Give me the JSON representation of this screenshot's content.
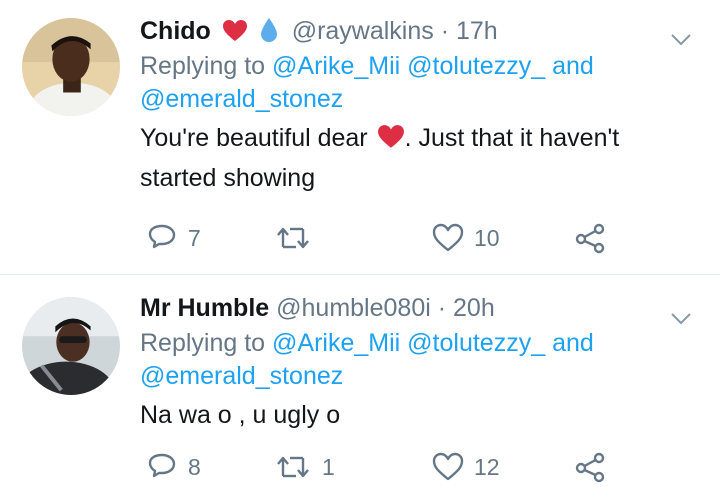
{
  "tweets": [
    {
      "name": "Chido",
      "name_emoji": [
        "red-heart",
        "water-droplet"
      ],
      "handle": "@raywalkins",
      "separator": "·",
      "time": "17h",
      "replying_prefix": "Replying to",
      "replying_users": [
        "@Arike_Mii",
        "@tolutezzy_"
      ],
      "replying_conjunction": "and",
      "replying_last": "@emerald_stonez",
      "text_before_emoji": "You're beautiful dear",
      "text_emoji": "red-heart",
      "text_after_emoji": ". Just that it haven't started showing",
      "reply_count": "7",
      "retweet_count": "",
      "like_count": "10"
    },
    {
      "name": "Mr Humble",
      "handle": "@humble080i",
      "separator": "·",
      "time": "20h",
      "replying_prefix": "Replying to",
      "replying_users": [
        "@Arike_Mii",
        "@tolutezzy_"
      ],
      "replying_conjunction": "and",
      "replying_last": "@emerald_stonez",
      "text": "Na wa o , u ugly o",
      "reply_count": "8",
      "retweet_count": "1",
      "like_count": "12"
    }
  ],
  "colors": {
    "text": "#14171a",
    "muted": "#657786",
    "link": "#1da1f2",
    "divider": "#e6ecf0",
    "heart": "#e0245e"
  }
}
